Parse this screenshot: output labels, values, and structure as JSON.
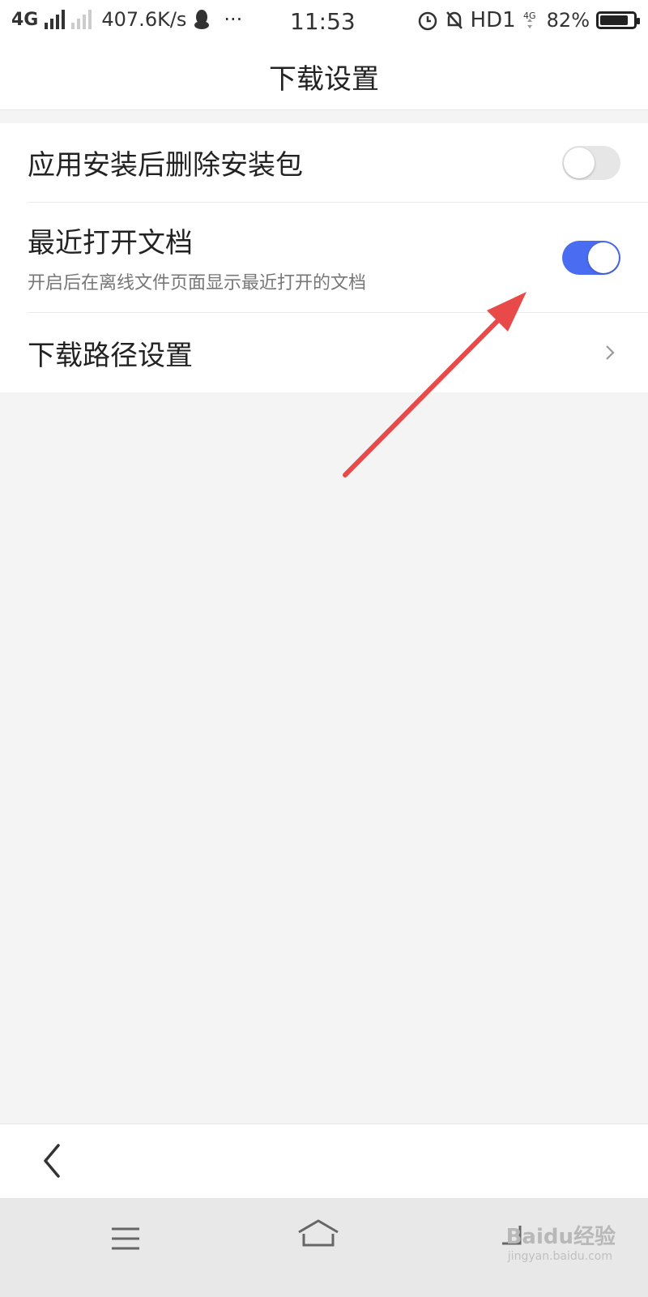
{
  "status_bar": {
    "network": "4G",
    "speed": "407.6K/s",
    "dots": "···",
    "time": "11:53",
    "hd": "HD1",
    "battery_percent": "82%",
    "battery_level": 0.82
  },
  "header": {
    "title": "下载设置"
  },
  "settings": {
    "items": [
      {
        "label": "应用安装后删除安装包",
        "toggle": "off"
      },
      {
        "label": "最近打开文档",
        "subtitle": "开启后在离线文件页面显示最近打开的文档",
        "toggle": "on"
      },
      {
        "label": "下载路径设置"
      }
    ]
  },
  "watermark": {
    "brand": "Baidu经验",
    "url": "jingyan.baidu.com"
  },
  "colors": {
    "accent": "#4a6cf0",
    "annotation": "#e84a4a",
    "background": "#f4f4f4"
  }
}
